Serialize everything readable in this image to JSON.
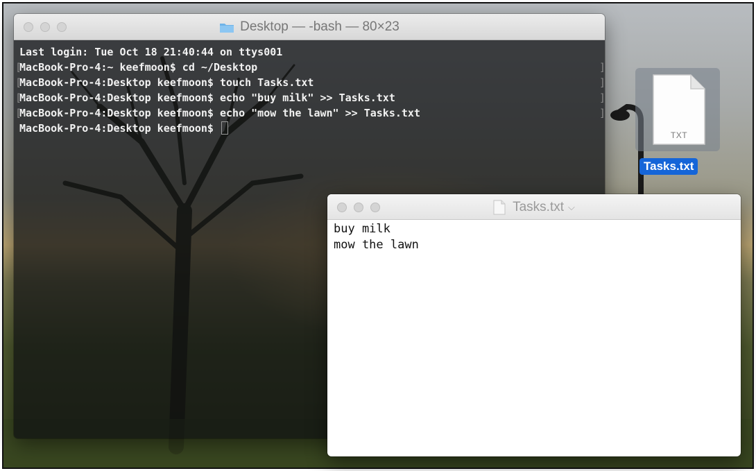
{
  "terminal": {
    "title": "Desktop — -bash — 80×23",
    "lines": [
      "Last login: Tue Oct 18 21:40:44 on ttys001",
      "MacBook-Pro-4:~ keefmoon$ cd ~/Desktop",
      "MacBook-Pro-4:Desktop keefmoon$ touch Tasks.txt",
      "MacBook-Pro-4:Desktop keefmoon$ echo \"buy milk\" >> Tasks.txt",
      "MacBook-Pro-4:Desktop keefmoon$ echo \"mow the lawn\" >> Tasks.txt",
      "MacBook-Pro-4:Desktop keefmoon$ "
    ]
  },
  "desktop_file": {
    "label": "Tasks.txt",
    "extension": "TXT",
    "icon": "txt-document-icon",
    "selection_color": "#1565d8"
  },
  "editor": {
    "title": "Tasks.txt",
    "title_chevron": "⌵",
    "lines": [
      "buy milk",
      "mow the lawn"
    ]
  }
}
